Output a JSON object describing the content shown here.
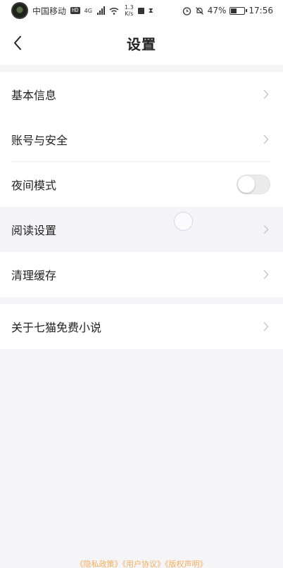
{
  "status_bar": {
    "carrier": "中国移动",
    "hd_badge": "HD",
    "network_type": "4G",
    "net_speed_value": "1.3",
    "net_speed_unit": "K/s",
    "battery_percent": "47%",
    "battery_level": 0.47,
    "time": "17:56"
  },
  "header": {
    "title": "设置"
  },
  "settings": {
    "group1": [
      {
        "label": "基本信息",
        "control": "chevron"
      },
      {
        "label": "账号与安全",
        "control": "chevron"
      },
      {
        "label": "夜间模式",
        "control": "toggle",
        "toggle_on": false
      },
      {
        "label": "阅读设置",
        "control": "chevron"
      },
      {
        "label": "清理缓存",
        "control": "chevron"
      }
    ],
    "group2": [
      {
        "label": "关于七猫免费小说",
        "control": "chevron"
      }
    ]
  },
  "footer": {
    "privacy": "《隐私政策》",
    "agreement": "《用户协议》",
    "copyright": "《版权声明》"
  },
  "colors": {
    "background": "#f5f4f7",
    "card": "#ffffff",
    "text": "#222222",
    "chevron": "#c8c8c8",
    "footer_link": "#f0b060"
  }
}
